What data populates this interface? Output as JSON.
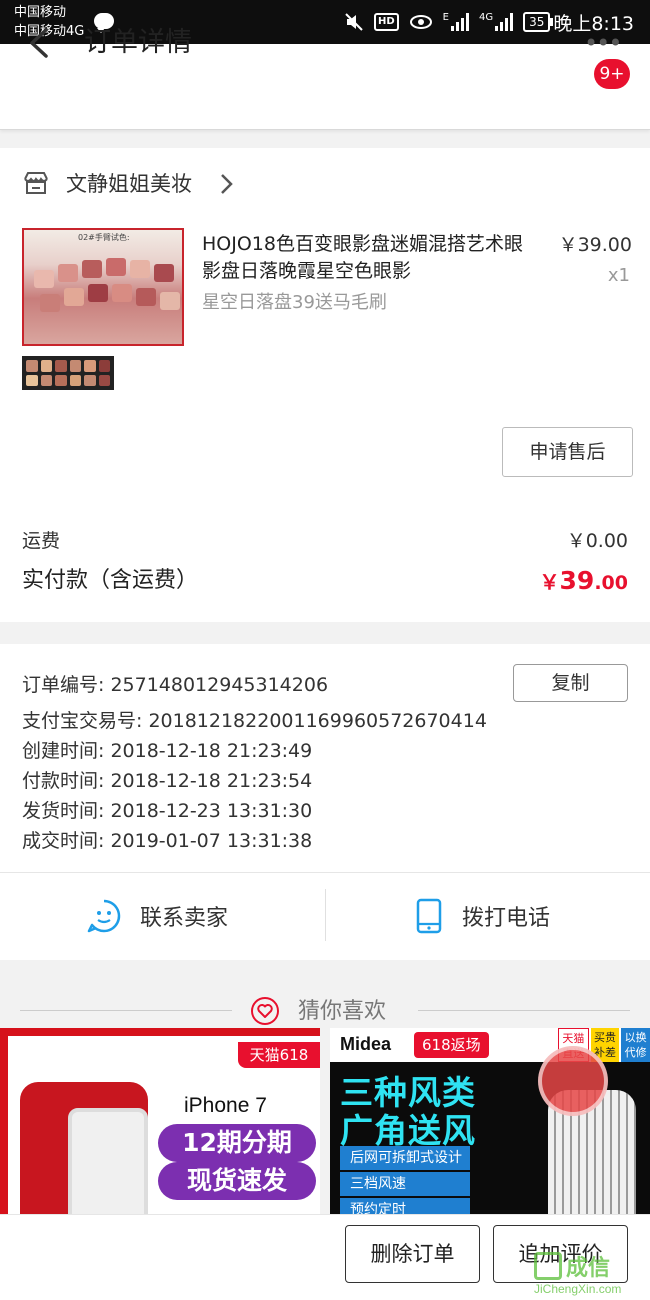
{
  "status_bar": {
    "carrier_line1": "中国移动",
    "carrier_line2": "中国移动4G",
    "hd": "HD",
    "network_e": "E",
    "network_4g": "4G",
    "battery": "35",
    "time": "晚上8:13"
  },
  "header": {
    "title": "订单详情",
    "more_icon": "more-dots-icon",
    "badge": "9+"
  },
  "shop": {
    "name": "文静姐姐美妆",
    "icon": "store-icon"
  },
  "product": {
    "title": "HOJO18色百变眼影盘迷媚混搭艺术眼影盘日落晚霞星空色眼影",
    "sku": "星空日落盘39送马毛刷",
    "price": "￥39.00",
    "quantity": "x1",
    "image_caption": "02#手臂试色:",
    "after_sale_label": "申请售后"
  },
  "costs": {
    "shipping_label": "运费",
    "shipping_value": "￥0.00",
    "paid_label": "实付款（含运费）",
    "paid_symbol": "￥",
    "paid_integer": "39",
    "paid_decimal": ".00"
  },
  "order_info": {
    "order_no": "订单编号: 257148012945314206",
    "alipay_no": "支付宝交易号: 2018121822001169960572670414",
    "created": "创建时间: 2018-12-18 21:23:49",
    "paid": "付款时间: 2018-12-18 21:23:54",
    "shipped": "发货时间: 2018-12-23 13:31:30",
    "completed": "成交时间: 2019-01-07 13:31:38",
    "copy_label": "复制"
  },
  "contact": {
    "seller_label": "联系卖家",
    "phone_label": "拨打电话"
  },
  "recommend": {
    "title": "猜你喜欢",
    "ad1": {
      "tag": "天猫618",
      "model": "iPhone 7",
      "line1": "12期分期",
      "line2": "现货速发"
    },
    "ad2": {
      "brand": "Midea",
      "tag": "618返场",
      "corner1": "天猫直送",
      "corner2": "买贵补差",
      "corner3": "以换代修",
      "headline1": "三种风类",
      "headline2": "广角送风",
      "feature1": "后网可拆卸式设计",
      "feature2": "三档风速",
      "feature3": "预约定时"
    }
  },
  "actions": {
    "delete_label": "删除订单",
    "review_label": "追加评价"
  },
  "watermark": {
    "text": "成信",
    "url": "JiChengXin.com"
  },
  "colors": {
    "accent_red": "#e8102e",
    "contact_blue": "#1e9ee8"
  }
}
